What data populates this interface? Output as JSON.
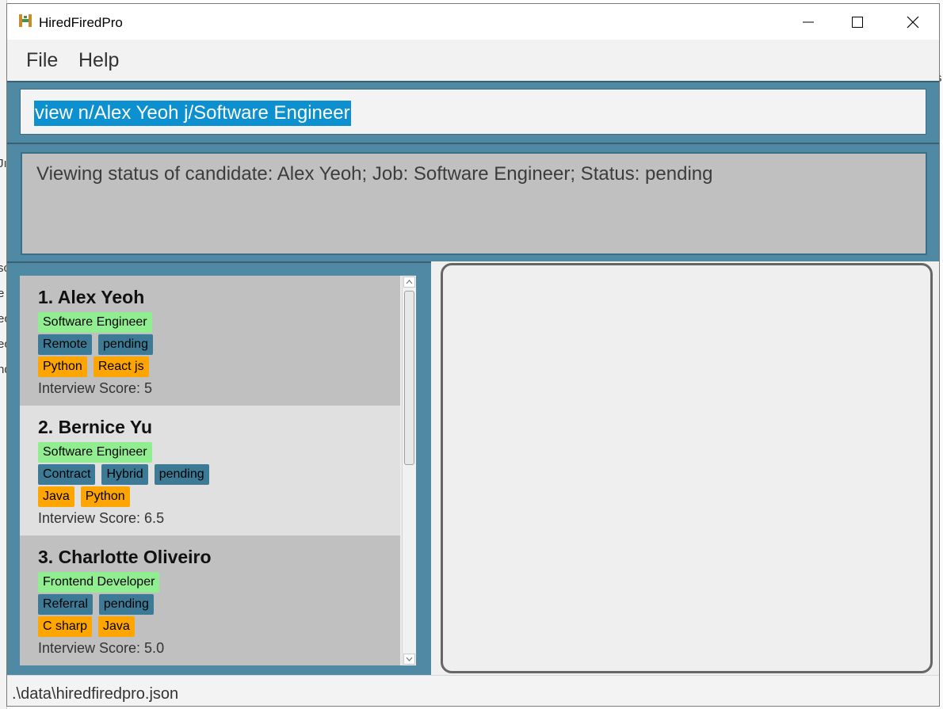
{
  "window": {
    "title": "HiredFiredPro",
    "icon": "hiredfiredpro-logo-icon",
    "controls": [
      "minimize-icon",
      "maximize-icon",
      "close-icon"
    ]
  },
  "menu": {
    "file": "File",
    "help": "Help"
  },
  "command": {
    "value": "view n/Alex Yeoh j/Software Engineer"
  },
  "result": {
    "message": "Viewing status of candidate: Alex Yeoh; Job: Software Engineer; Status: pending"
  },
  "candidates": [
    {
      "index_name": "1. Alex Yeoh",
      "job": "Software Engineer",
      "types": [
        "Remote",
        "pending"
      ],
      "skills": [
        "Python",
        "React js"
      ],
      "score": "Interview Score: 5"
    },
    {
      "index_name": "2. Bernice Yu",
      "job": "Software Engineer",
      "types": [
        "Contract",
        "Hybrid",
        "pending"
      ],
      "skills": [
        "Java",
        "Python"
      ],
      "score": "Interview Score: 6.5"
    },
    {
      "index_name": "3. Charlotte Oliveiro",
      "job": "Frontend Developer",
      "types": [
        "Referral",
        "pending"
      ],
      "skills": [
        "C sharp",
        "Java"
      ],
      "score": "Interview Score: 5.0"
    }
  ],
  "status_bar": {
    "path": ".\\data\\hiredfiredpro.json"
  },
  "colors": {
    "panel": "#5089a3",
    "job_tag": "#90ee90",
    "type_tag": "#3c7a96",
    "skill_tag": "#ffa500",
    "selection": "#0c90cf"
  }
}
